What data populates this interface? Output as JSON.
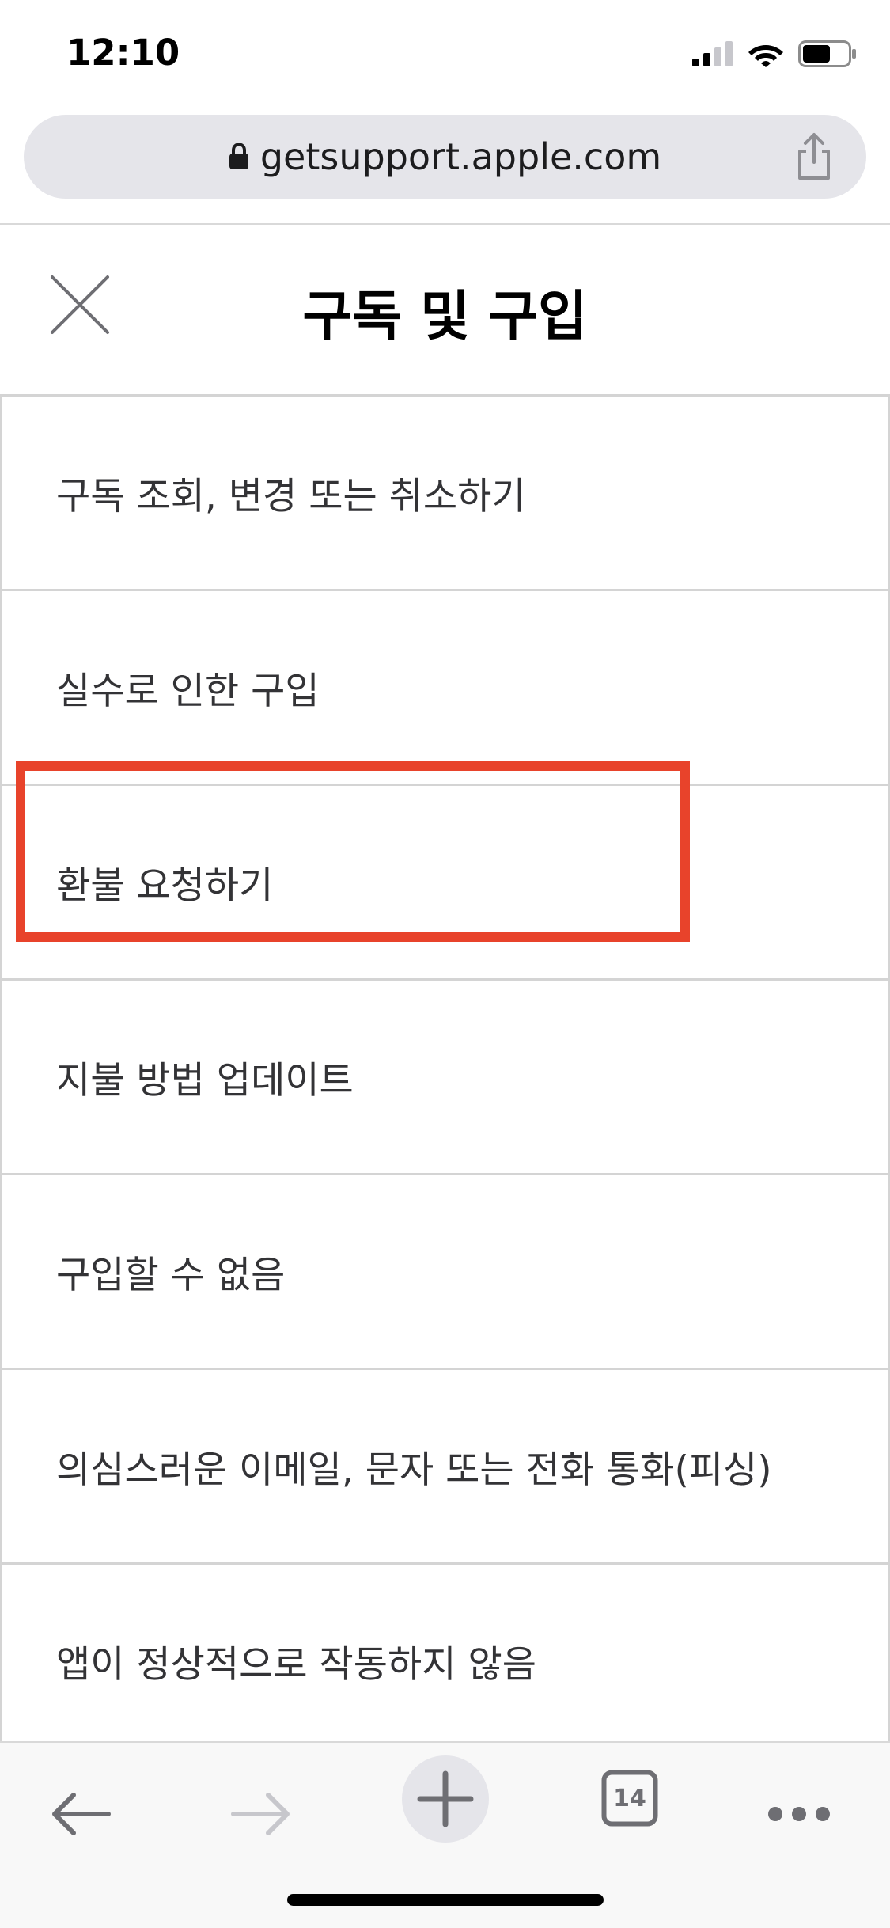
{
  "status_bar": {
    "time": "12:10"
  },
  "browser": {
    "url": "getsupport.apple.com",
    "tab_count": "14"
  },
  "page": {
    "title": "구독 및 구입",
    "items": [
      {
        "label": "구독 조회, 변경 또는 취소하기"
      },
      {
        "label": "실수로 인한 구입"
      },
      {
        "label": "환불 요청하기"
      },
      {
        "label": "지불 방법 업데이트"
      },
      {
        "label": "구입할 수 없음"
      },
      {
        "label": "의심스러운 이메일, 문자 또는 전화 통화(피싱)"
      },
      {
        "label": "앱이 정상적으로 작동하지 않음"
      }
    ]
  },
  "colors": {
    "highlight": "#e8432b",
    "url_bar_bg": "#e5e5ea",
    "divider": "#d4d4d4"
  },
  "icons": [
    "signal-icon",
    "wifi-icon",
    "battery-icon",
    "lock-icon",
    "share-icon",
    "close-icon",
    "back-arrow-icon",
    "forward-arrow-icon",
    "new-tab-plus-icon",
    "tabs-icon",
    "more-dots-icon"
  ]
}
